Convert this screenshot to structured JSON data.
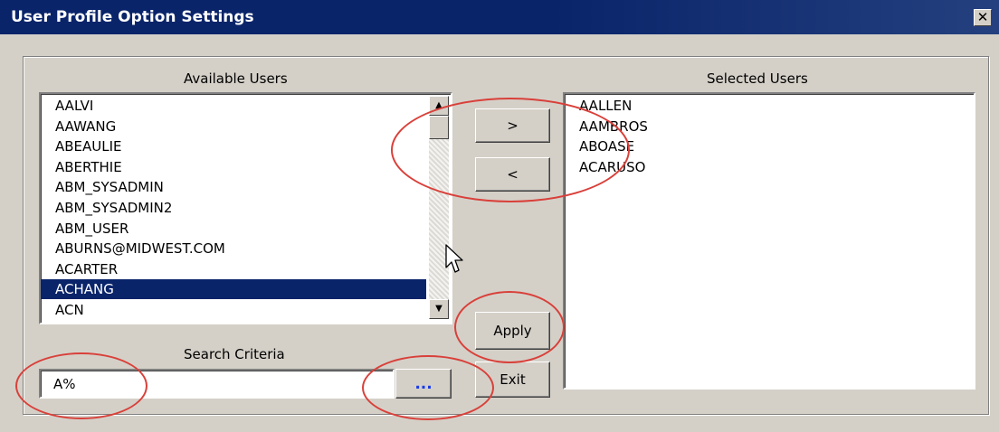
{
  "window": {
    "title": "User Profile Option Settings",
    "close_glyph": "✕"
  },
  "available": {
    "label": "Available Users",
    "items": [
      "AALVI",
      "AAWANG",
      "ABEAULIE",
      "ABERTHIE",
      "ABM_SYSADMIN",
      "ABM_SYSADMIN2",
      "ABM_USER",
      "ABURNS@MIDWEST.COM",
      "ACARTER",
      "ACHANG",
      "ACN"
    ],
    "selected_index": 9
  },
  "selected": {
    "label": "Selected Users",
    "items": [
      "AALLEN",
      "AAMBROS",
      "ABOASE",
      "ACARUSO"
    ]
  },
  "buttons": {
    "add": ">",
    "remove": "<",
    "apply": "Apply",
    "exit": "Exit",
    "search": "..."
  },
  "search": {
    "label": "Search Criteria",
    "value": "A%"
  },
  "colors": {
    "selection": "#0a246a",
    "annotation": "#d9403a",
    "search_button_text": "#1a3ce8"
  }
}
